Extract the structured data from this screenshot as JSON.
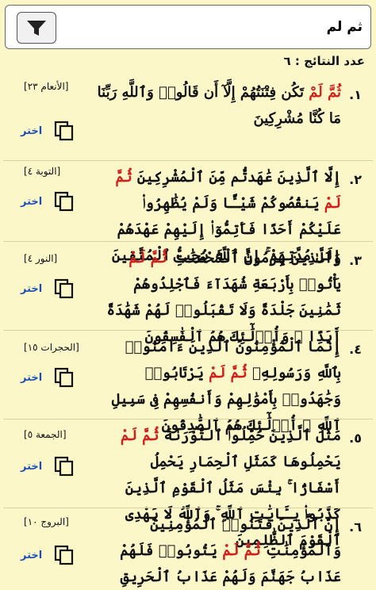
{
  "search": {
    "value": "ثم لم"
  },
  "results_count_label": "عدد النتائج : ٦",
  "choose_label": "اختر",
  "results": [
    {
      "number": "١.",
      "reference": "[الأنعام ٢٣]",
      "before": "",
      "highlight": "ثُمَّ لَمْ",
      "after": " تَكُن فِتْنَتُهُمْ إِلَّآ أَن قَالُوا۟ وَٱللَّهِ رَبِّنَا مَا كُنَّا مُشْرِكِينَ"
    },
    {
      "number": "٢.",
      "reference": "[التوبة ٤]",
      "before": "إِلَّا ٱلَّذِينَ عَٰهَدتُّم مِّنَ ٱلْمُشْرِكِينَ ",
      "highlight": "ثُمَّ لَمْ",
      "after": " يَنقُصُوكُمْ شَيْـًٔا وَلَمْ يُظَٰهِرُوا۟ عَلَيْكُمْ أَحَدًا فَأَتِمُّوٓا۟ إِلَيْهِمْ عَهْدَهُمْ إِلَىٰ مُدَّتِهِمْ ۚ إِنَّ ٱللَّهَ يُحِبُّ ٱلْمُتَّقِينَ"
    },
    {
      "number": "٣.",
      "reference": "[النور ٤]",
      "before": "وَٱلَّذِينَ يَرْمُونَ ٱلْمُحْصَنَٰتِ ",
      "highlight": "ثُمَّ لَمْ",
      "after": " يَأْتُوا۟ بِأَرْبَعَةِ شُهَدَآءَ فَٱجْلِدُوهُمْ ثَمَٰنِينَ جَلْدَةً وَلَا تَقْبَلُوا۟ لَهُمْ شَهَٰدَةً أَبَدًا ۚ وَأُو۟لَٰٓئِكَ هُمُ ٱلْفَٰسِقُونَ"
    },
    {
      "number": "٤.",
      "reference": "[الحجرات ١٥]",
      "before": "إِنَّمَا ٱلْمُؤْمِنُونَ ٱلَّذِينَ ءَامَنُوا۟ بِٱللَّهِ وَرَسُولِهِۦ ",
      "highlight": "ثُمَّ لَمْ",
      "after": " يَرْتَابُوا۟ وَجَٰهَدُوا۟ بِأَمْوَٰلِهِمْ وَأَنفُسِهِمْ فِى سَبِيلِ ٱللَّهِ ۚ أُو۟لَٰٓئِكَ هُمُ ٱلصَّٰدِقُونَ"
    },
    {
      "number": "٥.",
      "reference": "[الجمعة ٥]",
      "before": "مَثَلُ ٱلَّذِينَ حُمِّلُوا۟ ٱلتَّوْرَىٰةَ ",
      "highlight": "ثُمَّ لَمْ",
      "after": " يَحْمِلُوهَا كَمَثَلِ ٱلْحِمَارِ يَحْمِلُ أَسْفَارًۢا ۚ بِئْسَ مَثَلُ ٱلْقَوْمِ ٱلَّذِينَ كَذَّبُوا۟ بِـَٔايَٰتِ ٱللَّهِ ۚ وَٱللَّهُ لَا يَهْدِى ٱلْقَوْمَ ٱلظَّٰلِمِينَ"
    },
    {
      "number": "٦.",
      "reference": "[البروج ١٠]",
      "before": "إِنَّ ٱلَّذِينَ فَتَنُوا۟ ٱلْمُؤْمِنِينَ وَٱلْمُؤْمِنَٰتِ ",
      "highlight": "ثُمَّ لَمْ",
      "after": " يَتُوبُوا۟ فَلَهُمْ عَذَابُ جَهَنَّمَ وَلَهُمْ عَذَابُ ٱلْحَرِيقِ"
    }
  ]
}
